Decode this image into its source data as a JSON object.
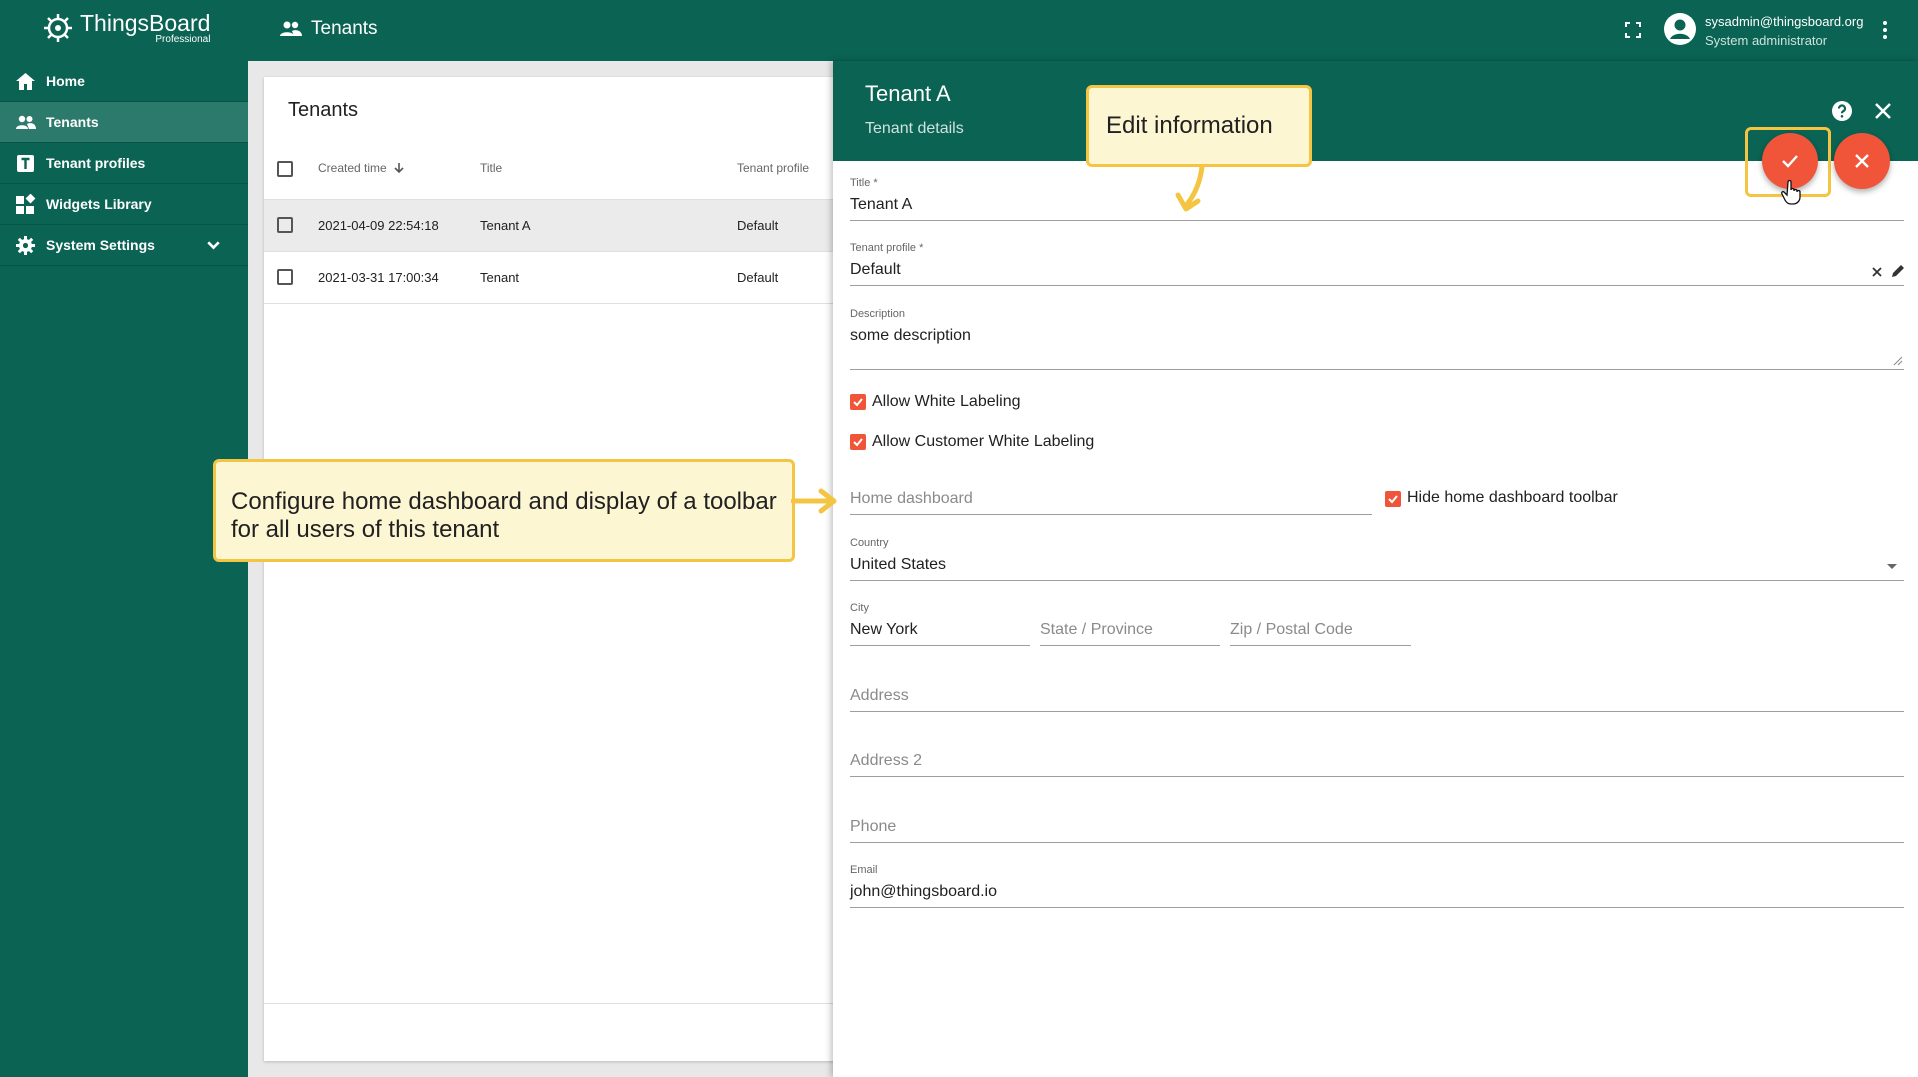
{
  "app": {
    "logo_name": "ThingsBoard",
    "logo_sub": "Professional",
    "page_title": "Tenants",
    "user_email": "sysadmin@thingsboard.org",
    "user_role": "System administrator",
    "colors": {
      "primary": "#0a6353",
      "accent": "#f0553a",
      "callout": "#f4c542"
    }
  },
  "sidebar": {
    "items": [
      {
        "label": "Home",
        "icon": "home-icon"
      },
      {
        "label": "Tenants",
        "icon": "tenants-icon"
      },
      {
        "label": "Tenant profiles",
        "icon": "tenant-profile-icon"
      },
      {
        "label": "Widgets Library",
        "icon": "widgets-icon"
      },
      {
        "label": "System Settings",
        "icon": "gear-icon"
      }
    ]
  },
  "list": {
    "title": "Tenants",
    "columns": [
      "Created time",
      "Title",
      "Tenant profile"
    ],
    "rows": [
      {
        "created": "2021-04-09 22:54:18",
        "title": "Tenant A",
        "profile": "Default"
      },
      {
        "created": "2021-03-31 17:00:34",
        "title": "Tenant",
        "profile": "Default"
      }
    ]
  },
  "details": {
    "title": "Tenant A",
    "subtitle": "Tenant details",
    "fields": {
      "title_label": "Title *",
      "title_value": "Tenant A",
      "profile_label": "Tenant profile *",
      "profile_value": "Default",
      "description_label": "Description",
      "description_value": "some description",
      "allow_wl": "Allow White Labeling",
      "allow_cwl": "Allow Customer White Labeling",
      "home_dashboard_ph": "Home dashboard",
      "hide_toolbar": "Hide home dashboard toolbar",
      "country_label": "Country",
      "country_value": "United States",
      "city_label": "City",
      "city_value": "New York",
      "state_ph": "State / Province",
      "zip_ph": "Zip / Postal Code",
      "address_ph": "Address",
      "address2_ph": "Address 2",
      "phone_ph": "Phone",
      "email_label": "Email",
      "email_value": "john@thingsboard.io"
    }
  },
  "callouts": {
    "edit": "Edit information",
    "home_line1": "Configure home dashboard and display of a toolbar",
    "home_line2": "for all users of this tenant"
  }
}
